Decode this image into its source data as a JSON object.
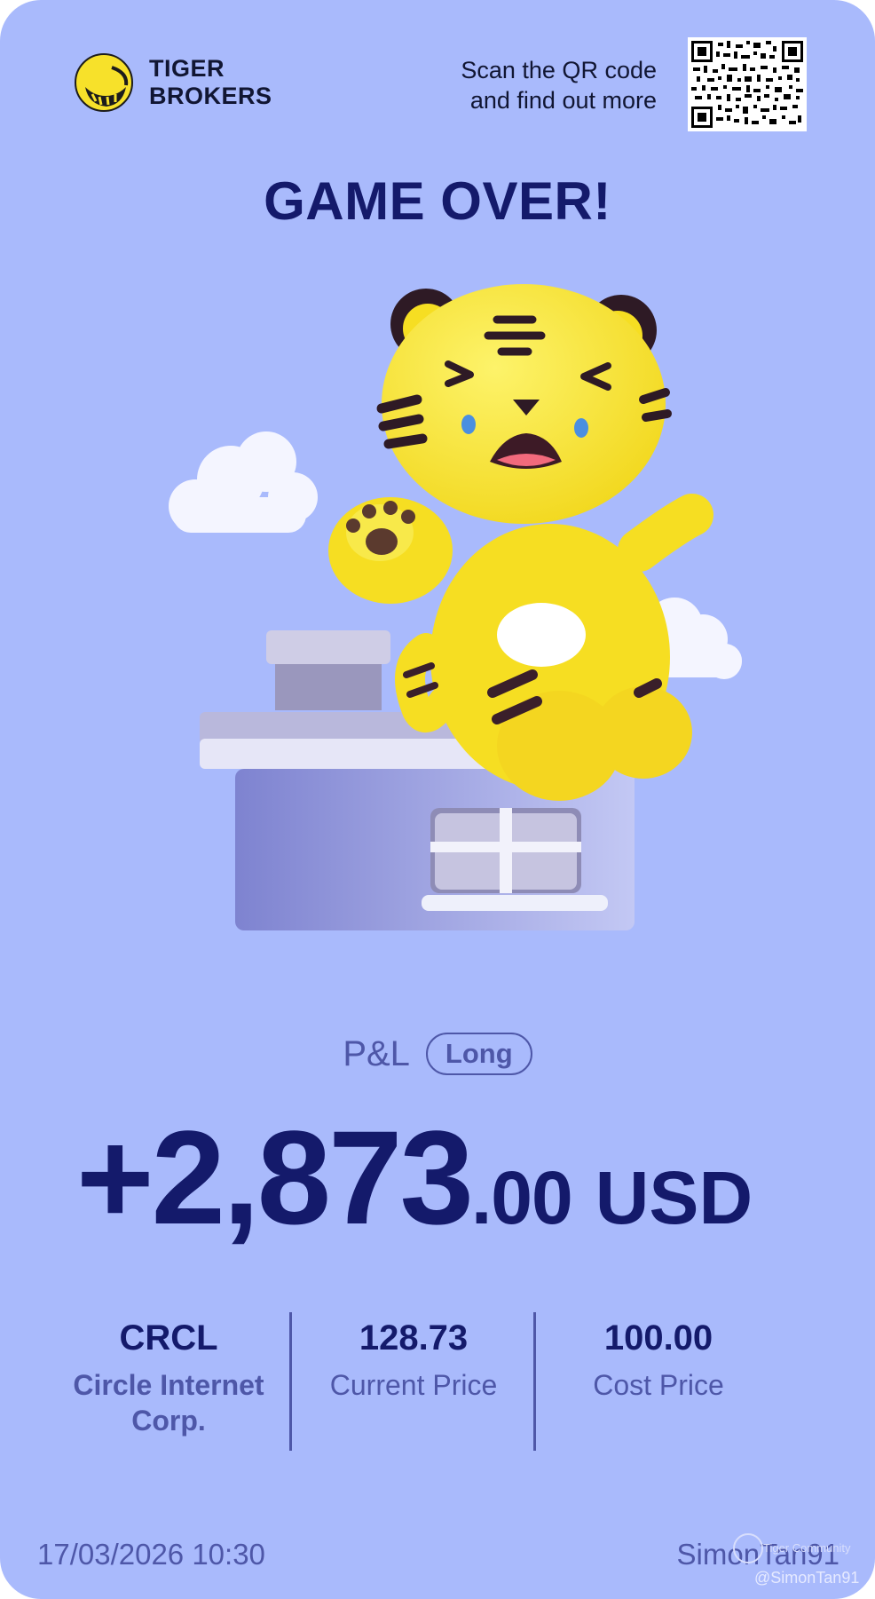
{
  "brand": {
    "name_line1": "TIGER",
    "name_line2": "BROKERS",
    "logo_icon": "tiger-logo-icon"
  },
  "qr": {
    "text_line1": "Scan the QR code",
    "text_line2": "and find out more",
    "icon": "qr-code-icon"
  },
  "title": "GAME OVER!",
  "illustration": {
    "icon": "crying-tiger-on-house-illustration"
  },
  "pnl": {
    "label": "P&L",
    "position_tag": "Long",
    "amount_int": "+2,873",
    "amount_dec": ".00",
    "currency": "USD"
  },
  "stats": {
    "symbol": "CRCL",
    "company_line1": "Circle Internet",
    "company_line2": "Corp.",
    "current_price": "128.73",
    "current_price_label": "Current Price",
    "cost_price": "100.00",
    "cost_price_label": "Cost Price"
  },
  "footer": {
    "datetime": "17/03/2026 10:30",
    "username": "SimonTan91",
    "watermark_line1": "Tiger Community",
    "watermark_line2": "@SimonTan91"
  },
  "colors": {
    "background": "#a9bafc",
    "primary_text": "#141a6b",
    "secondary_text": "#4e57a8",
    "tiger_yellow": "#f7e12a"
  }
}
